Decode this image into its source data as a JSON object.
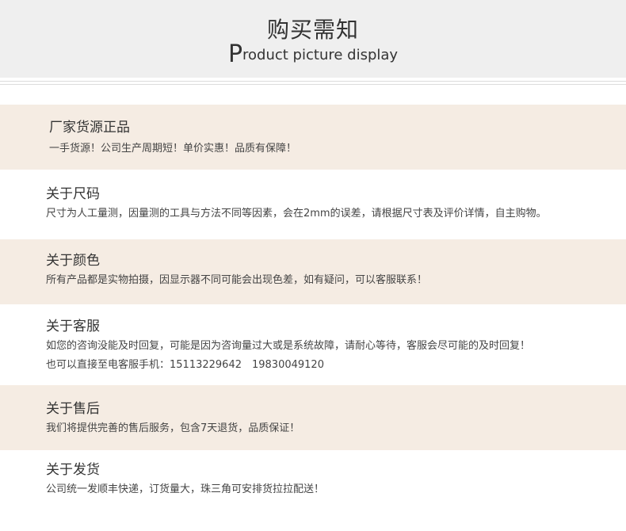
{
  "header": {
    "title": "购买需知",
    "subtitle_first": "P",
    "subtitle_rest": "roduct picture display"
  },
  "sections": [
    {
      "title": "厂家货源正品",
      "lines": [
        "一手货源！公司生产周期短！单价实惠！品质有保障！"
      ]
    },
    {
      "title": "关于尺码",
      "lines": [
        "尺寸为人工量测，因量测的工具与方法不同等因素，会在2mm的误差，请根据尺寸表及评价详情，自主购物。"
      ]
    },
    {
      "title": "关于颜色",
      "lines": [
        "所有产品都是实物拍摄，因显示器不同可能会出现色差，如有疑问，可以客服联系！"
      ]
    },
    {
      "title": "关于客服",
      "lines": [
        "如您的咨询没能及时回复，可能是因为咨询量过大或是系统故障，请耐心等待，客服会尽可能的及时回复！",
        "也可以直接至电客服手机：15113229642　19830049120"
      ]
    },
    {
      "title": "关于售后",
      "lines": [
        "我们将提供完善的售后服务，包含7天退货，品质保证！"
      ]
    },
    {
      "title": "关于发货",
      "lines": [
        "公司统一发顺丰快递，订货量大，珠三角可安排货拉拉配送！"
      ]
    }
  ],
  "colors": {
    "header_bg": "#efefef",
    "shaded_bg": "#f5ece3",
    "text": "#333333"
  }
}
